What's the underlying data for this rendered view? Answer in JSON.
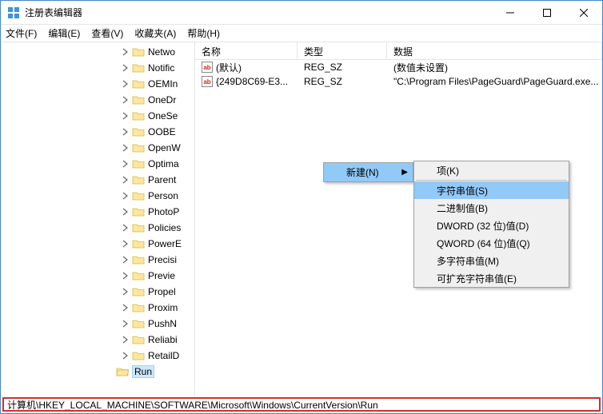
{
  "window": {
    "title": "注册表编辑器"
  },
  "menus": {
    "file": "文件(F)",
    "edit": "编辑(E)",
    "view": "查看(V)",
    "fav": "收藏夹(A)",
    "help": "帮助(H)"
  },
  "tree": {
    "items": [
      "Netwo",
      "Notific",
      "OEMIn",
      "OneDr",
      "OneSe",
      "OOBE",
      "OpenW",
      "Optima",
      "Parent",
      "Person",
      "PhotoP",
      "Policies",
      "PowerE",
      "Precisi",
      "Previe",
      "Propel",
      "Proxim",
      "PushN",
      "Reliabi",
      "RetailD"
    ],
    "selected": "Run"
  },
  "list": {
    "cols": {
      "name": "名称",
      "type": "类型",
      "data": "数据"
    },
    "rows": [
      {
        "name": "(默认)",
        "type": "REG_SZ",
        "data": "(数值未设置)"
      },
      {
        "name": "{249D8C69-E3...",
        "type": "REG_SZ",
        "data": "\"C:\\Program Files\\PageGuard\\PageGuard.exe..."
      }
    ]
  },
  "context": {
    "new": "新建(N)",
    "sub": {
      "key": "项(K)",
      "string": "字符串值(S)",
      "binary": "二进制值(B)",
      "dword": "DWORD (32 位)值(D)",
      "qword": "QWORD (64 位)值(Q)",
      "multi": "多字符串值(M)",
      "expand": "可扩充字符串值(E)"
    }
  },
  "status": "计算机\\HKEY_LOCAL_MACHINE\\SOFTWARE\\Microsoft\\Windows\\CurrentVersion\\Run"
}
